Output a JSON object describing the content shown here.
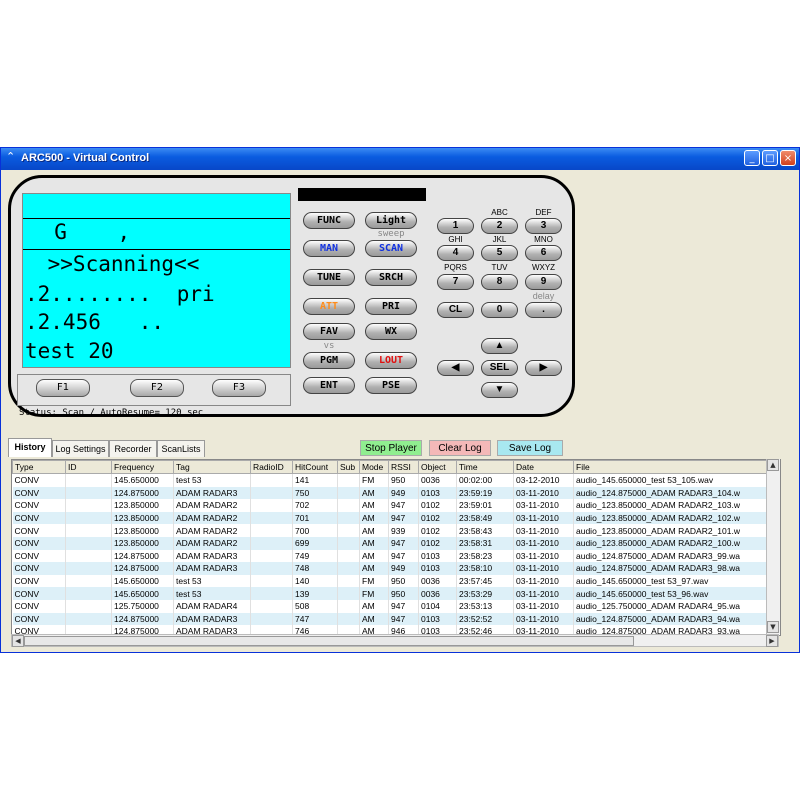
{
  "window": {
    "title": "ARC500 - Virtual Control",
    "controls": [
      "_",
      "□",
      "×"
    ]
  },
  "lcd": {
    "line1": "  G    ,",
    "line2": " >>Scanning<<",
    "line3": ".2........  pri",
    "line4": ".2.456   ..",
    "line5": "test 20"
  },
  "fkeys": [
    "F1",
    "F2",
    "F3"
  ],
  "status": "Status: Scan / AutoResume= 120 sec",
  "radio_buttons": {
    "func": "FUNC",
    "light": "Light",
    "sweep": "sweep",
    "man": "MAN",
    "scan": "SCAN",
    "tune": "TUNE",
    "srch": "SRCH",
    "att": "ATT",
    "pri": "PRI",
    "fav": "FAV",
    "wx": "WX",
    "vs": "vs",
    "pgm": "PGM",
    "lout": "LOUT",
    "ent": "ENT",
    "pse": "PSE"
  },
  "keypad": {
    "k1": "1",
    "k2": "2",
    "k3": "3",
    "k4": "4",
    "k5": "5",
    "k6": "6",
    "k7": "7",
    "k8": "8",
    "k9": "9",
    "cl": "CL",
    "k0": "0",
    "dot": ".",
    "sel": "SEL",
    "abc": "ABC",
    "def": "DEF",
    "ghi": "GHI",
    "jkl": "JKL",
    "mno": "MNO",
    "pqrs": "PQRS",
    "tuv": "TUV",
    "wxyz": "WXYZ",
    "delay": "delay"
  },
  "tabs": [
    "History",
    "Log Settings",
    "Recorder",
    "ScanLists"
  ],
  "actions": {
    "stop_player": "Stop Player",
    "clear_log": "Clear Log",
    "save_log": "Save Log"
  },
  "colors": {
    "lcd": "#00ffff",
    "stop_player": "#90ee90",
    "clear_log": "#f4b8b8",
    "save_log": "#a8e8f0",
    "row_alt": "#ddf0f8"
  },
  "table": {
    "columns": [
      "Type",
      "ID",
      "Frequency",
      "Tag",
      "RadioID",
      "HitCount",
      "Sub",
      "Mode",
      "RSSI",
      "Object",
      "Time",
      "Date",
      "File"
    ],
    "rows": [
      [
        "CONV",
        "",
        "145.650000",
        "test 53",
        "",
        "141",
        "",
        "FM",
        "950",
        "0036",
        "00:02:00",
        "03-12-2010",
        "audio_145.650000_test 53_105.wav"
      ],
      [
        "CONV",
        "",
        "124.875000",
        "ADAM RADAR3",
        "",
        "750",
        "",
        "AM",
        "949",
        "0103",
        "23:59:19",
        "03-11-2010",
        "audio_124.875000_ADAM RADAR3_104.w"
      ],
      [
        "CONV",
        "",
        "123.850000",
        "ADAM RADAR2",
        "",
        "702",
        "",
        "AM",
        "947",
        "0102",
        "23:59:01",
        "03-11-2010",
        "audio_123.850000_ADAM RADAR2_103.w"
      ],
      [
        "CONV",
        "",
        "123.850000",
        "ADAM RADAR2",
        "",
        "701",
        "",
        "AM",
        "947",
        "0102",
        "23:58:49",
        "03-11-2010",
        "audio_123.850000_ADAM RADAR2_102.w"
      ],
      [
        "CONV",
        "",
        "123.850000",
        "ADAM RADAR2",
        "",
        "700",
        "",
        "AM",
        "939",
        "0102",
        "23:58:43",
        "03-11-2010",
        "audio_123.850000_ADAM RADAR2_101.w"
      ],
      [
        "CONV",
        "",
        "123.850000",
        "ADAM RADAR2",
        "",
        "699",
        "",
        "AM",
        "947",
        "0102",
        "23:58:31",
        "03-11-2010",
        "audio_123.850000_ADAM RADAR2_100.w"
      ],
      [
        "CONV",
        "",
        "124.875000",
        "ADAM RADAR3",
        "",
        "749",
        "",
        "AM",
        "947",
        "0103",
        "23:58:23",
        "03-11-2010",
        "audio_124.875000_ADAM RADAR3_99.wa"
      ],
      [
        "CONV",
        "",
        "124.875000",
        "ADAM RADAR3",
        "",
        "748",
        "",
        "AM",
        "949",
        "0103",
        "23:58:10",
        "03-11-2010",
        "audio_124.875000_ADAM RADAR3_98.wa"
      ],
      [
        "CONV",
        "",
        "145.650000",
        "test 53",
        "",
        "140",
        "",
        "FM",
        "950",
        "0036",
        "23:57:45",
        "03-11-2010",
        "audio_145.650000_test 53_97.wav"
      ],
      [
        "CONV",
        "",
        "145.650000",
        "test 53",
        "",
        "139",
        "",
        "FM",
        "950",
        "0036",
        "23:53:29",
        "03-11-2010",
        "audio_145.650000_test 53_96.wav"
      ],
      [
        "CONV",
        "",
        "125.750000",
        "ADAM RADAR4",
        "",
        "508",
        "",
        "AM",
        "947",
        "0104",
        "23:53:13",
        "03-11-2010",
        "audio_125.750000_ADAM RADAR4_95.wa"
      ],
      [
        "CONV",
        "",
        "124.875000",
        "ADAM RADAR3",
        "",
        "747",
        "",
        "AM",
        "947",
        "0103",
        "23:52:52",
        "03-11-2010",
        "audio_124.875000_ADAM RADAR3_94.wa"
      ],
      [
        "CONV",
        "",
        "124.875000",
        "ADAM RADAR3",
        "",
        "746",
        "",
        "AM",
        "946",
        "0103",
        "23:52:46",
        "03-11-2010",
        "audio_124.875000_ADAM RADAR3_93.wa"
      ]
    ]
  }
}
